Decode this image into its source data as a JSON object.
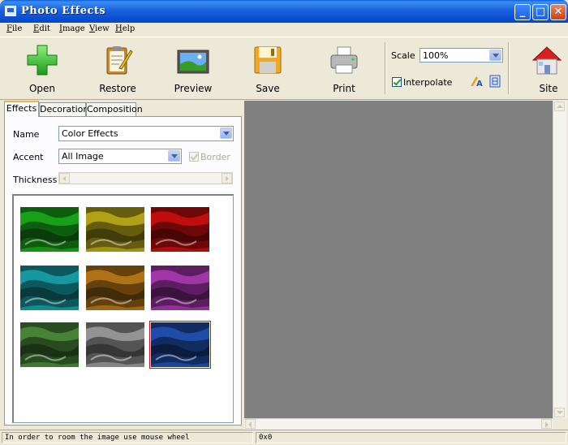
{
  "window": {
    "title": "Photo Effects"
  },
  "menu": [
    "File",
    "Edit",
    "Image",
    "View",
    "Help"
  ],
  "toolbar": {
    "open": "Open",
    "restore": "Restore",
    "preview": "Preview",
    "save": "Save",
    "print": "Print",
    "scale_label": "Scale",
    "scale_value": "100%",
    "interpolate_label": "Interpolate",
    "interpolate_checked": true,
    "site": "Site"
  },
  "tabs": [
    "Effects",
    "Decoration",
    "Composition"
  ],
  "effects": {
    "name_label": "Name",
    "name_value": "Color Effects",
    "accent_label": "Accent",
    "accent_value": "All Image",
    "border_label": "Border",
    "thickness_label": "Thickness",
    "thumbnails": [
      {
        "tint": "#1aa81a",
        "selected": false
      },
      {
        "tint": "#b8a818",
        "selected": false
      },
      {
        "tint": "#c81010",
        "selected": false
      },
      {
        "tint": "#18a0a8",
        "selected": false
      },
      {
        "tint": "#b87818",
        "selected": false
      },
      {
        "tint": "#a838b0",
        "selected": false
      },
      {
        "tint": "#4a8a3a",
        "selected": false
      },
      {
        "tint": "#9a9a9a",
        "selected": false
      },
      {
        "tint": "#2050b0",
        "selected": true
      }
    ]
  },
  "status": {
    "hint": "In order to room the image use mouse wheel",
    "coords": "0x0"
  }
}
